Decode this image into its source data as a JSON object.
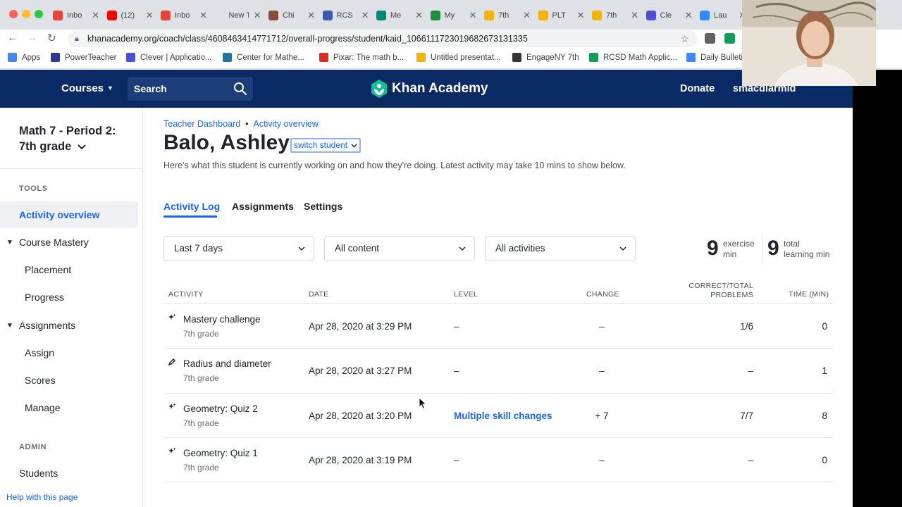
{
  "browser": {
    "tabs": [
      {
        "label": "Inbo",
        "icon": "gmail-icon",
        "color": "#ea4335"
      },
      {
        "label": "(12)",
        "icon": "youtube-icon",
        "color": "#ff0000"
      },
      {
        "label": "Inbo",
        "icon": "gmail-icon",
        "color": "#ea4335"
      },
      {
        "label": "New Ta",
        "icon": "",
        "color": ""
      },
      {
        "label": "Chi",
        "icon": "chrome-icon",
        "color": "#8a4b3c"
      },
      {
        "label": "RCS",
        "icon": "calendar-icon",
        "color": "#3b5aa7"
      },
      {
        "label": "Me",
        "icon": "meet-icon",
        "color": "#00897b"
      },
      {
        "label": "My",
        "icon": "drive-icon",
        "color": "#1e8e3e"
      },
      {
        "label": "7th",
        "icon": "slides-icon",
        "color": "#f4b400"
      },
      {
        "label": "PLT",
        "icon": "slides-icon",
        "color": "#f4b400"
      },
      {
        "label": "7th",
        "icon": "slides-icon",
        "color": "#f4b400"
      },
      {
        "label": "Cle",
        "icon": "clever-icon",
        "color": "#4b4fd9"
      },
      {
        "label": "Lau",
        "icon": "zoom-icon",
        "color": "#2d8cff"
      }
    ],
    "url": "khanacademy.org/coach/class/4608463414771712/overall-progress/student/kaid_1066111723019682673131335",
    "bookmarks": [
      {
        "label": "Apps",
        "icon": "apps-grid-icon",
        "color": "#4285f4"
      },
      {
        "label": "PowerTeacher",
        "icon": "powerteacher-icon",
        "color": "#2b3a8f"
      },
      {
        "label": "Clever | Applicatio...",
        "icon": "clever-icon",
        "color": "#4b4fd9"
      },
      {
        "label": "Center for Mathe...",
        "icon": "wordpress-icon",
        "color": "#21759b"
      },
      {
        "label": "Pixar: The math b...",
        "icon": "pixar-icon",
        "color": "#d93025"
      },
      {
        "label": "Untitled presentat...",
        "icon": "slides-icon",
        "color": "#f4b400"
      },
      {
        "label": "EngageNY 7th",
        "icon": "engageny-icon",
        "color": "#333333"
      },
      {
        "label": "RCSD Math Applic...",
        "icon": "sheets-icon",
        "color": "#0f9d58"
      },
      {
        "label": "Daily Bulleti",
        "icon": "docs-icon",
        "color": "#4285f4"
      }
    ]
  },
  "header": {
    "courses_label": "Courses",
    "search_label": "Search",
    "logo_text": "Khan Academy",
    "donate_label": "Donate",
    "user_name": "smacdiarmid"
  },
  "sidebar": {
    "class_name": "Math 7 - Period 2: 7th grade",
    "tools_label": "TOOLS",
    "admin_label": "ADMIN",
    "items": [
      {
        "label": "Activity overview"
      },
      {
        "label": "Course Mastery"
      },
      {
        "label": "Placement"
      },
      {
        "label": "Progress"
      },
      {
        "label": "Assignments"
      },
      {
        "label": "Assign"
      },
      {
        "label": "Scores"
      },
      {
        "label": "Manage"
      },
      {
        "label": "Students"
      }
    ],
    "help_label": "Help with this page"
  },
  "main": {
    "breadcrumb": [
      "Teacher Dashboard",
      "Activity overview"
    ],
    "student_name": "Balo, Ashley",
    "switch_label": "switch student",
    "subtitle": "Here's what this student is currently working on and how they're doing. Latest activity may take 10 mins to show below.",
    "tabs": [
      "Activity Log",
      "Assignments",
      "Settings"
    ],
    "filters": [
      "Last 7 days",
      "All content",
      "All activities"
    ],
    "stats": [
      {
        "value": "9",
        "label_line1": "exercise",
        "label_line2": "min"
      },
      {
        "value": "9",
        "label_line1": "total",
        "label_line2": "learning min"
      }
    ],
    "table": {
      "headers": [
        "ACTIVITY",
        "DATE",
        "LEVEL",
        "CHANGE",
        "CORRECT/TOTAL",
        "PROBLEMS",
        "TIME (MIN)"
      ],
      "rows": [
        {
          "icon": "sparkle-icon",
          "activity": "Mastery challenge",
          "course": "7th grade",
          "date": "Apr 28, 2020 at 3:29 PM",
          "level": "–",
          "change": "–",
          "correct": "1/6",
          "time": "0"
        },
        {
          "icon": "pencil-icon",
          "activity": "Radius and diameter",
          "course": "7th grade",
          "date": "Apr 28, 2020 at 3:27 PM",
          "level": "–",
          "change": "–",
          "correct": "–",
          "time": "1"
        },
        {
          "icon": "sparkle-icon",
          "activity": "Geometry: Quiz 2",
          "course": "7th grade",
          "date": "Apr 28, 2020 at 3:20 PM",
          "level": "Multiple skill changes",
          "change": "+ 7",
          "correct": "7/7",
          "time": "8"
        },
        {
          "icon": "sparkle-icon",
          "activity": "Geometry: Quiz 1",
          "course": "7th grade",
          "date": "Apr 28, 2020 at 3:19 PM",
          "level": "–",
          "change": "–",
          "correct": "–",
          "time": "0"
        }
      ]
    }
  },
  "colors": {
    "header_bg": "#0a2a66",
    "accent": "#1865f2",
    "ka_green": "#14bf96"
  }
}
